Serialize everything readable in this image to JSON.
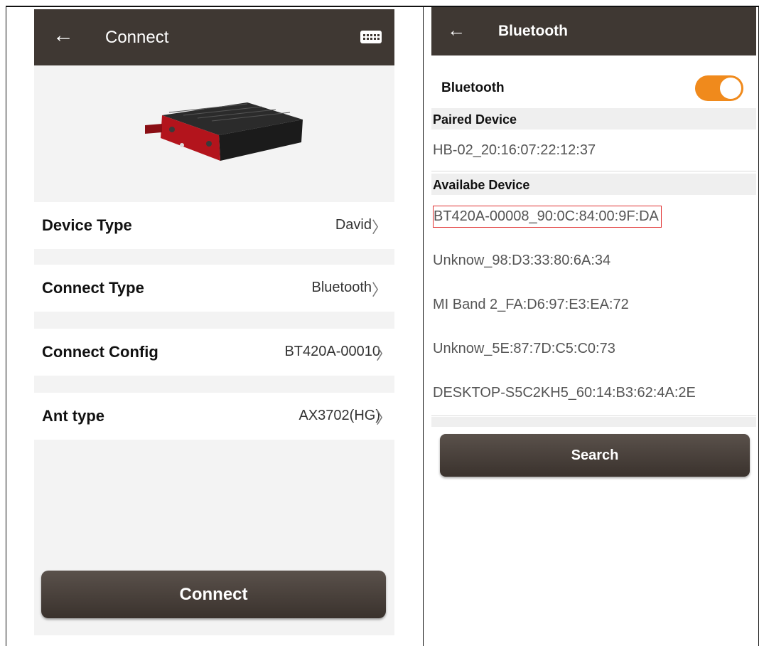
{
  "connect_screen": {
    "title": "Connect",
    "back_icon": "arrow-left-icon",
    "keyboard_icon": "keyboard-icon",
    "rows": [
      {
        "label": "Device Type",
        "value": "David"
      },
      {
        "label": "Connect Type",
        "value": "Bluetooth"
      },
      {
        "label": "Connect Config",
        "value": "BT420A-00010"
      },
      {
        "label": "Ant type",
        "value": "AX3702(HG)"
      }
    ],
    "connect_button": "Connect",
    "chevron": ">"
  },
  "bluetooth_screen": {
    "title": "Bluetooth",
    "back_icon": "arrow-left-icon",
    "bluetooth_label": "Bluetooth",
    "bluetooth_on": true,
    "toggle_color": "#f08a1c",
    "paired_header": "Paired Device",
    "paired_devices": [
      "HB-02_20:16:07:22:12:37"
    ],
    "available_header": "Availabe Device",
    "available_devices": [
      "BT420A-00008_90:0C:84:00:9F:DA",
      "Unknow_98:D3:33:80:6A:34",
      "MI Band 2_FA:D6:97:E3:EA:72",
      "Unknow_5E:87:7D:C5:C0:73",
      "DESKTOP-S5C2KH5_60:14:B3:62:4A:2E"
    ],
    "search_button": "Search"
  }
}
